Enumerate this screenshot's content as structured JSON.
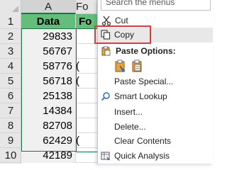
{
  "sheet": {
    "columns": [
      "A",
      "Fo"
    ],
    "rows": [
      "1",
      "2",
      "3",
      "4",
      "5",
      "6",
      "7",
      "8",
      "9",
      "10"
    ],
    "col_a": [
      "Data",
      "29833",
      "56767",
      "58776",
      "56718",
      "25138",
      "14384",
      "82708",
      "62429",
      "42189"
    ],
    "col_b": [
      "Fo",
      "",
      "",
      "(",
      "(",
      "",
      "",
      "",
      "(",
      ""
    ]
  },
  "menu": {
    "search_placeholder": "Search the menus",
    "cut": "Cut",
    "copy": "Copy",
    "paste_options": "Paste Options:",
    "paste_special": "Paste Special...",
    "smart_lookup": "Smart Lookup",
    "insert": "Insert...",
    "delete": "Delete...",
    "clear_contents": "Clear Contents",
    "quick_analysis": "Quick Analysis"
  },
  "colors": {
    "header_fill": "#63be7b",
    "highlight_border": "#e03c3c",
    "excel_green": "#217346"
  },
  "icons": {
    "cut": "scissors-icon",
    "copy": "copy-icon",
    "paste_clipboard": "paste-icon",
    "paste_values": "paste-values-icon",
    "smart_lookup": "search-icon",
    "quick_analysis": "quick-analysis-icon"
  }
}
